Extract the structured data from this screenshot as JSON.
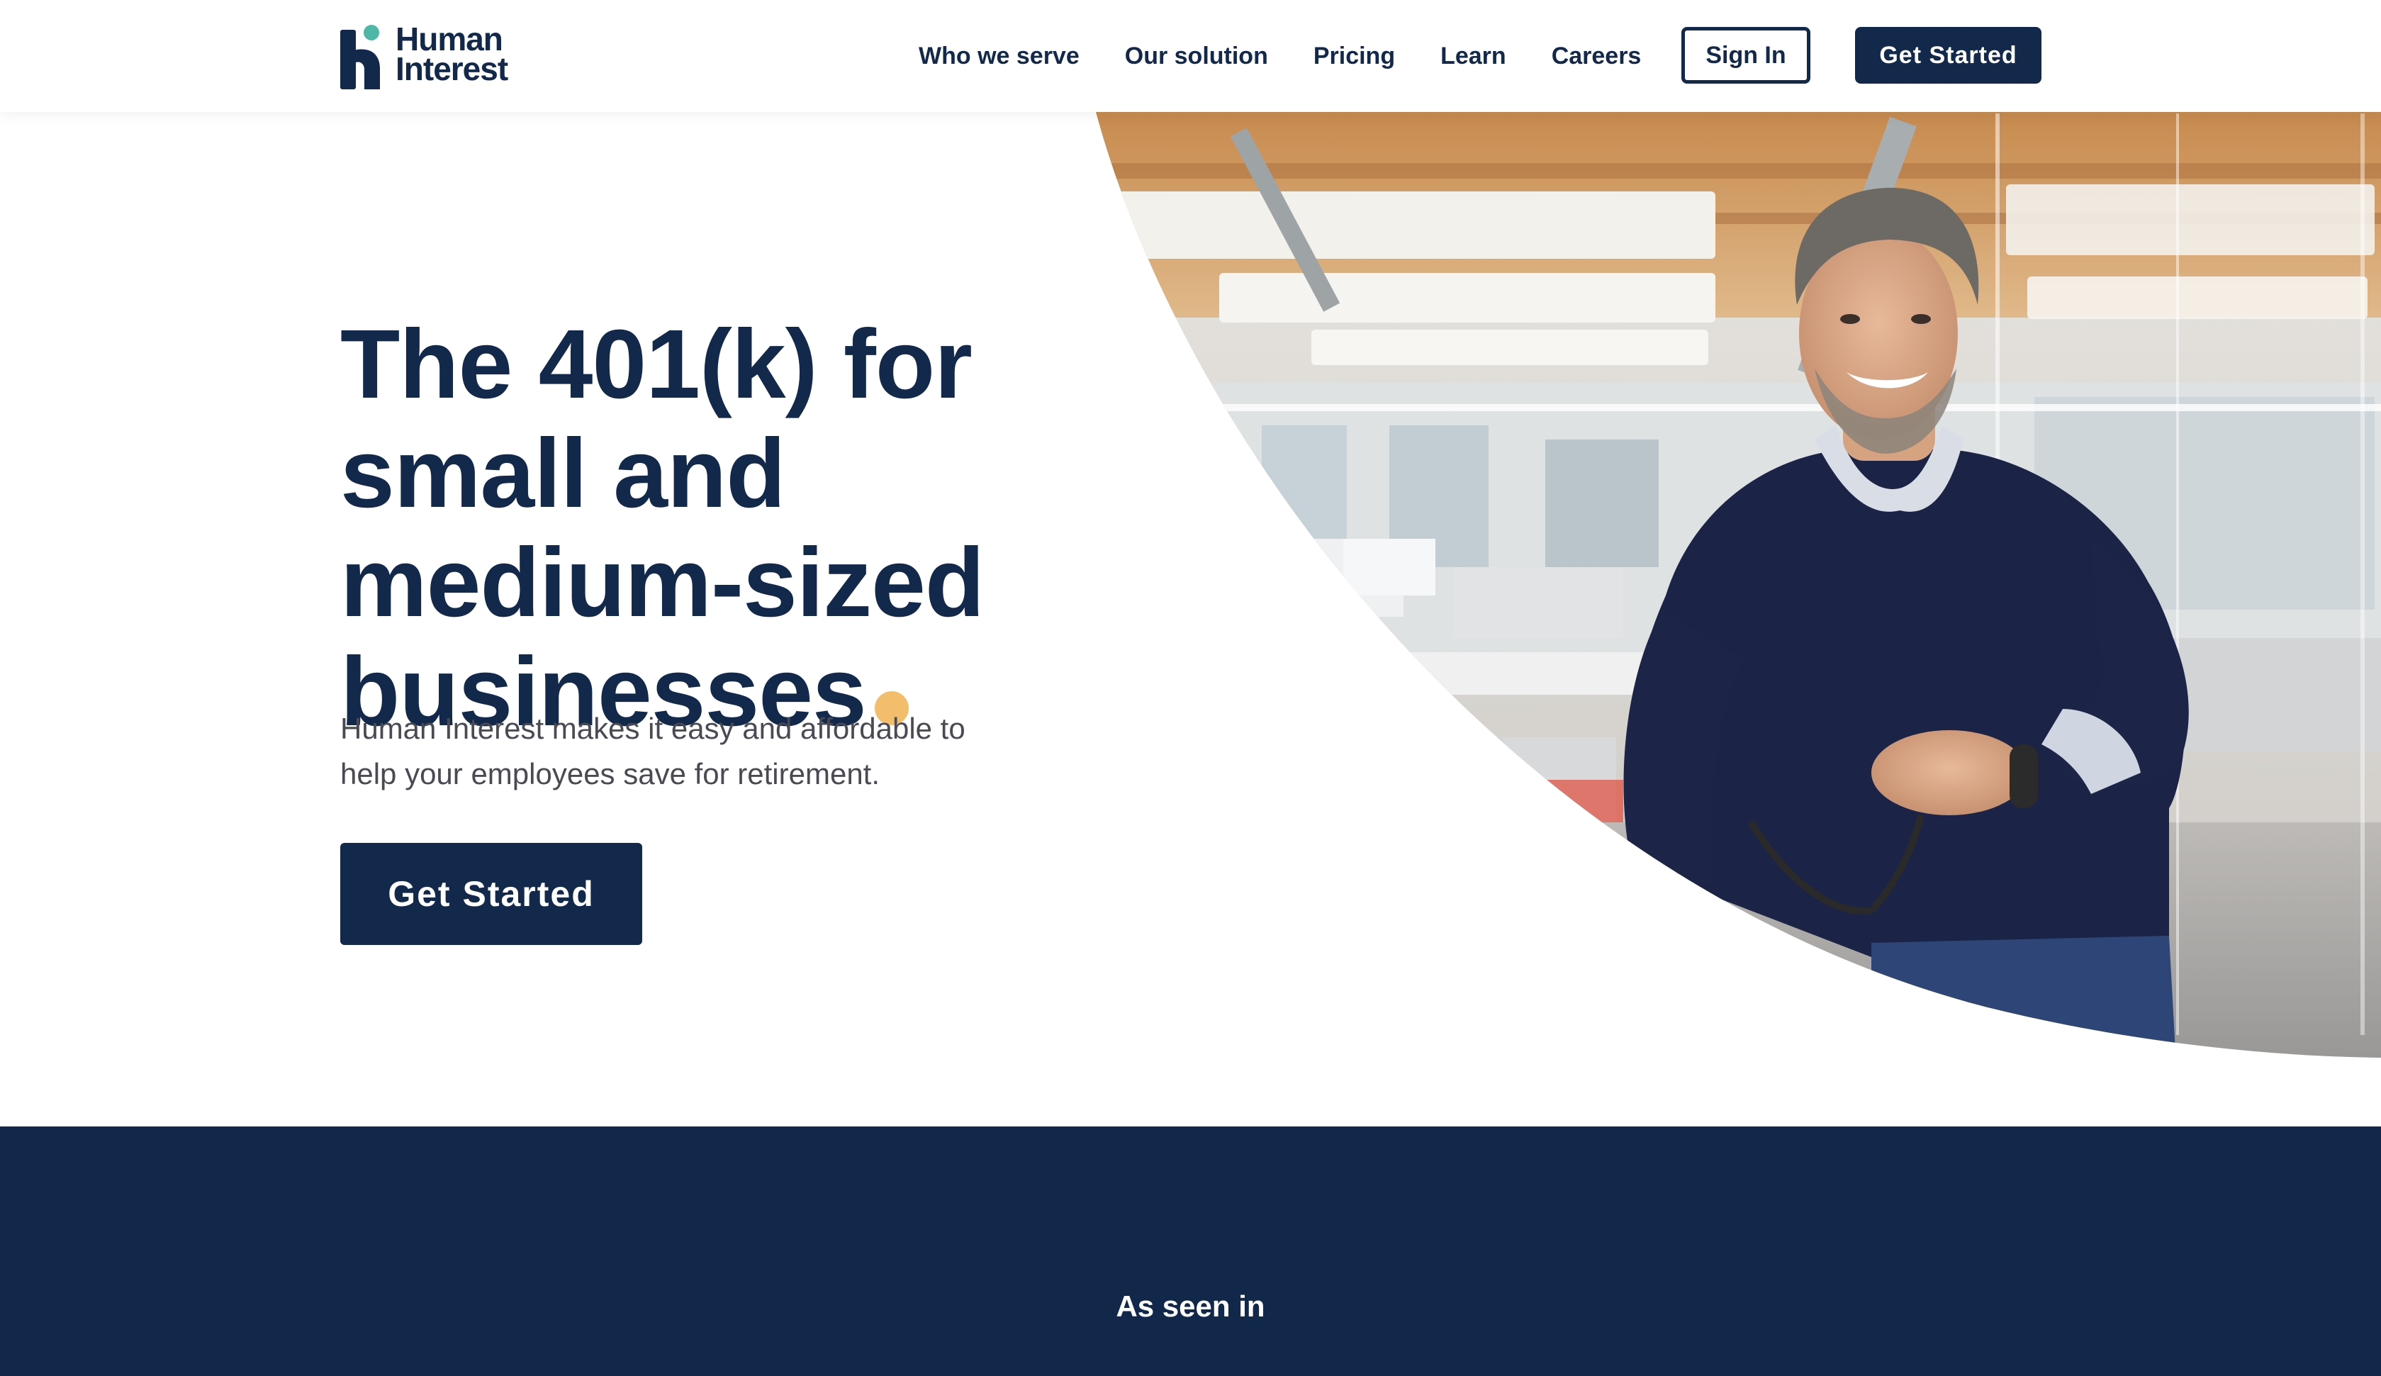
{
  "brand": {
    "name_line1": "Human",
    "name_line2": "Interest",
    "colors": {
      "navy": "#13294b",
      "teal": "#4cb8a5",
      "accent_dot": "#f2be6b"
    }
  },
  "nav": {
    "items": [
      "Who we serve",
      "Our solution",
      "Pricing",
      "Learn",
      "Careers"
    ],
    "sign_in": "Sign In",
    "get_started": "Get Started"
  },
  "hero": {
    "headline_lines": [
      "The 401(k) for",
      "small and",
      "medium-sized",
      "businesses"
    ],
    "subtext_lines": [
      "Human Interest makes it easy and affordable to",
      "help your employees save for retirement."
    ],
    "cta": "Get Started"
  },
  "press": {
    "title": "As seen in"
  }
}
